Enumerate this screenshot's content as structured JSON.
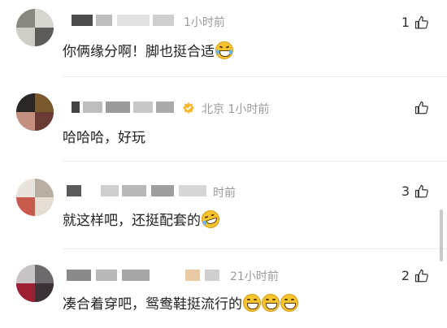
{
  "comments": [
    {
      "time": "1小时前",
      "location": "",
      "text": "你俩缘分啊！脚也挺合适",
      "emojis": [
        "laugh-tears-emoji"
      ],
      "likes": "1"
    },
    {
      "time": "1小时前",
      "location": "北京",
      "text": "哈哈哈，好玩",
      "emojis": [],
      "likes": ""
    },
    {
      "time": "时前",
      "location": "",
      "text": "就这样吧，还挺配套的",
      "emojis": [
        "smirk-tears-emoji"
      ],
      "likes": "3"
    },
    {
      "time": "21小时前",
      "location": "",
      "text": "凑合着穿吧，鸳鸯鞋挺流行的",
      "emojis": [
        "grin-emoji",
        "grin-emoji",
        "grin-emoji"
      ],
      "likes": "2"
    }
  ],
  "colors": {
    "meta": "#9a9a9a",
    "text": "#222222",
    "divider": "#ededed",
    "verified_badge": "#f5b82e"
  }
}
